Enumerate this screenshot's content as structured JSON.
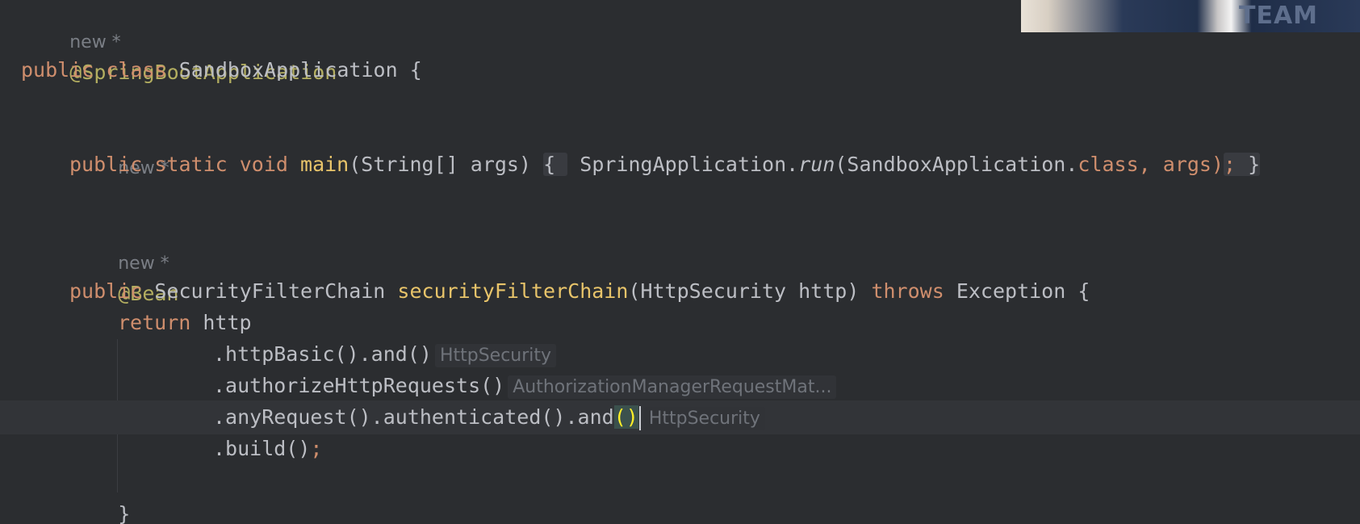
{
  "editor": {
    "lines": {
      "l1_hint": "new *",
      "l2_annotation": "@SpringBootApplication",
      "l3_public": "public",
      "l3_class": "class",
      "l3_name": "SandboxApplication",
      "l3_brace": "{",
      "l5_hint": "new *",
      "l6_public": "public",
      "l6_static": "static",
      "l6_void": "void",
      "l6_main": "main",
      "l6_params": "(String[] args)",
      "l6_open": "{",
      "l6_call_prefix": "SpringApplication.",
      "l6_run": "run",
      "l6_call_arg": "(SandboxApplication.",
      "l6_classkw": "class",
      "l6_args_end": ", args)",
      "l6_semi": ";",
      "l6_close": "}",
      "l8_hint": "new *",
      "l9_annotation": "@Bean",
      "l10_public": "public",
      "l10_type": "SecurityFilterChain",
      "l10_method": "securityFilterChain",
      "l10_params": "(HttpSecurity http)",
      "l10_throws": "throws",
      "l10_exc": "Exception {",
      "l11_return": "return",
      "l11_http": "http",
      "l12_code": ".httpBasic().and()",
      "l12_inlay": "HttpSecurity",
      "l13_code": ".authorizeHttpRequests()",
      "l13_inlay": "AuthorizationManagerRequestMat...",
      "l14_code": ".anyRequest().authenticated().and",
      "l14_parens": "()",
      "l14_inlay": "HttpSecurity",
      "l15_code": ".build()",
      "l15_semi": ";",
      "l16_brace": "}"
    }
  },
  "colors": {
    "background": "#2b2d30",
    "keyword": "#cf8e6d",
    "annotation": "#b3ae60",
    "method_decl": "#e8c46a",
    "text": "#bcbec4",
    "hint": "#7a7e85"
  },
  "webcam": {
    "text": "TEAM"
  }
}
